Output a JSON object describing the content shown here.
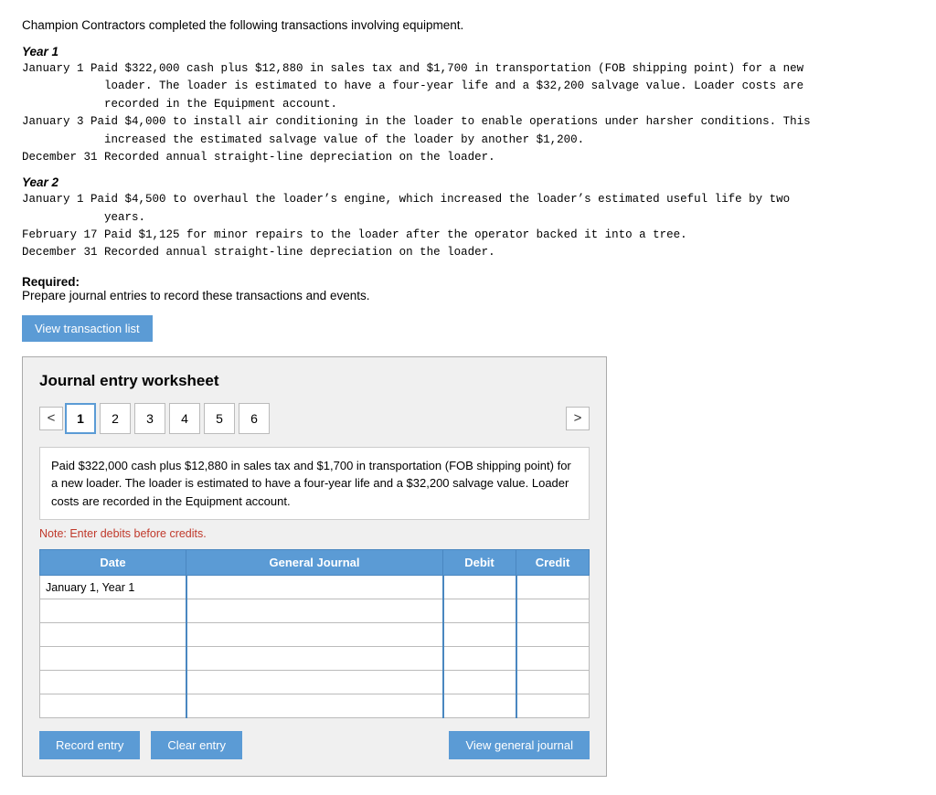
{
  "intro": {
    "text": "Champion Contractors completed the following transactions involving equipment."
  },
  "year1": {
    "header": "Year 1",
    "transactions": [
      {
        "date": "January 1",
        "text": "Paid $322,000 cash plus $12,880 in sales tax and $1,700 in transportation (FOB shipping point) for a new\n         loader. The loader is estimated to have a four-year life and a $32,200 salvage value. Loader costs are\n         recorded in the Equipment account."
      },
      {
        "date": "January 3",
        "text": "Paid $4,000 to install air conditioning in the loader to enable operations under harsher conditions. This\n         increased the estimated salvage value of the loader by another $1,200."
      },
      {
        "date": "December 31",
        "text": "Recorded annual straight-line depreciation on the loader."
      }
    ]
  },
  "year2": {
    "header": "Year 2",
    "transactions": [
      {
        "date": "January 1",
        "text": "Paid $4,500 to overhaul the loader’s engine, which increased the loader’s estimated useful life by two\n         years."
      },
      {
        "date": "February 17",
        "text": "Paid $1,125 for minor repairs to the loader after the operator backed it into a tree."
      },
      {
        "date": "December 31",
        "text": "Recorded annual straight-line depreciation on the loader."
      }
    ]
  },
  "required": {
    "label": "Required:",
    "text": "Prepare journal entries to record these transactions and events."
  },
  "view_transaction_btn": "View transaction list",
  "worksheet": {
    "title": "Journal entry worksheet",
    "tabs": [
      "1",
      "2",
      "3",
      "4",
      "5",
      "6"
    ],
    "active_tab": 0,
    "left_arrow": "<",
    "right_arrow": ">",
    "transaction_desc": "Paid $322,000 cash plus $12,880 in sales tax and $1,700 in transportation (FOB shipping point) for a new loader. The loader is estimated to have a four-year life and a $32,200 salvage value. Loader costs are recorded in the Equipment account.",
    "note": "Note: Enter debits before credits.",
    "table": {
      "headers": [
        "Date",
        "General Journal",
        "Debit",
        "Credit"
      ],
      "rows": [
        {
          "date": "January 1, Year 1",
          "journal": "",
          "debit": "",
          "credit": ""
        },
        {
          "date": "",
          "journal": "",
          "debit": "",
          "credit": ""
        },
        {
          "date": "",
          "journal": "",
          "debit": "",
          "credit": ""
        },
        {
          "date": "",
          "journal": "",
          "debit": "",
          "credit": ""
        },
        {
          "date": "",
          "journal": "",
          "debit": "",
          "credit": ""
        },
        {
          "date": "",
          "journal": "",
          "debit": "",
          "credit": ""
        }
      ]
    },
    "buttons": {
      "record": "Record entry",
      "clear": "Clear entry",
      "view_journal": "View general journal"
    }
  }
}
